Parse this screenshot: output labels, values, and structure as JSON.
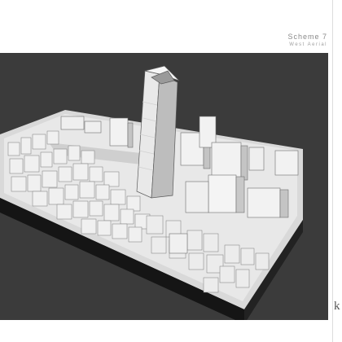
{
  "header": {
    "title": "Scheme 7",
    "subtitle": "West Aerial"
  },
  "brand": {
    "logo_text": "k"
  },
  "colors": {
    "background": "#ffffff",
    "viewport": "#3b3b3b",
    "base_dark": "#1d1d1d",
    "building_light": "#f1f1f1",
    "building_shade": "#c9c9c9"
  }
}
